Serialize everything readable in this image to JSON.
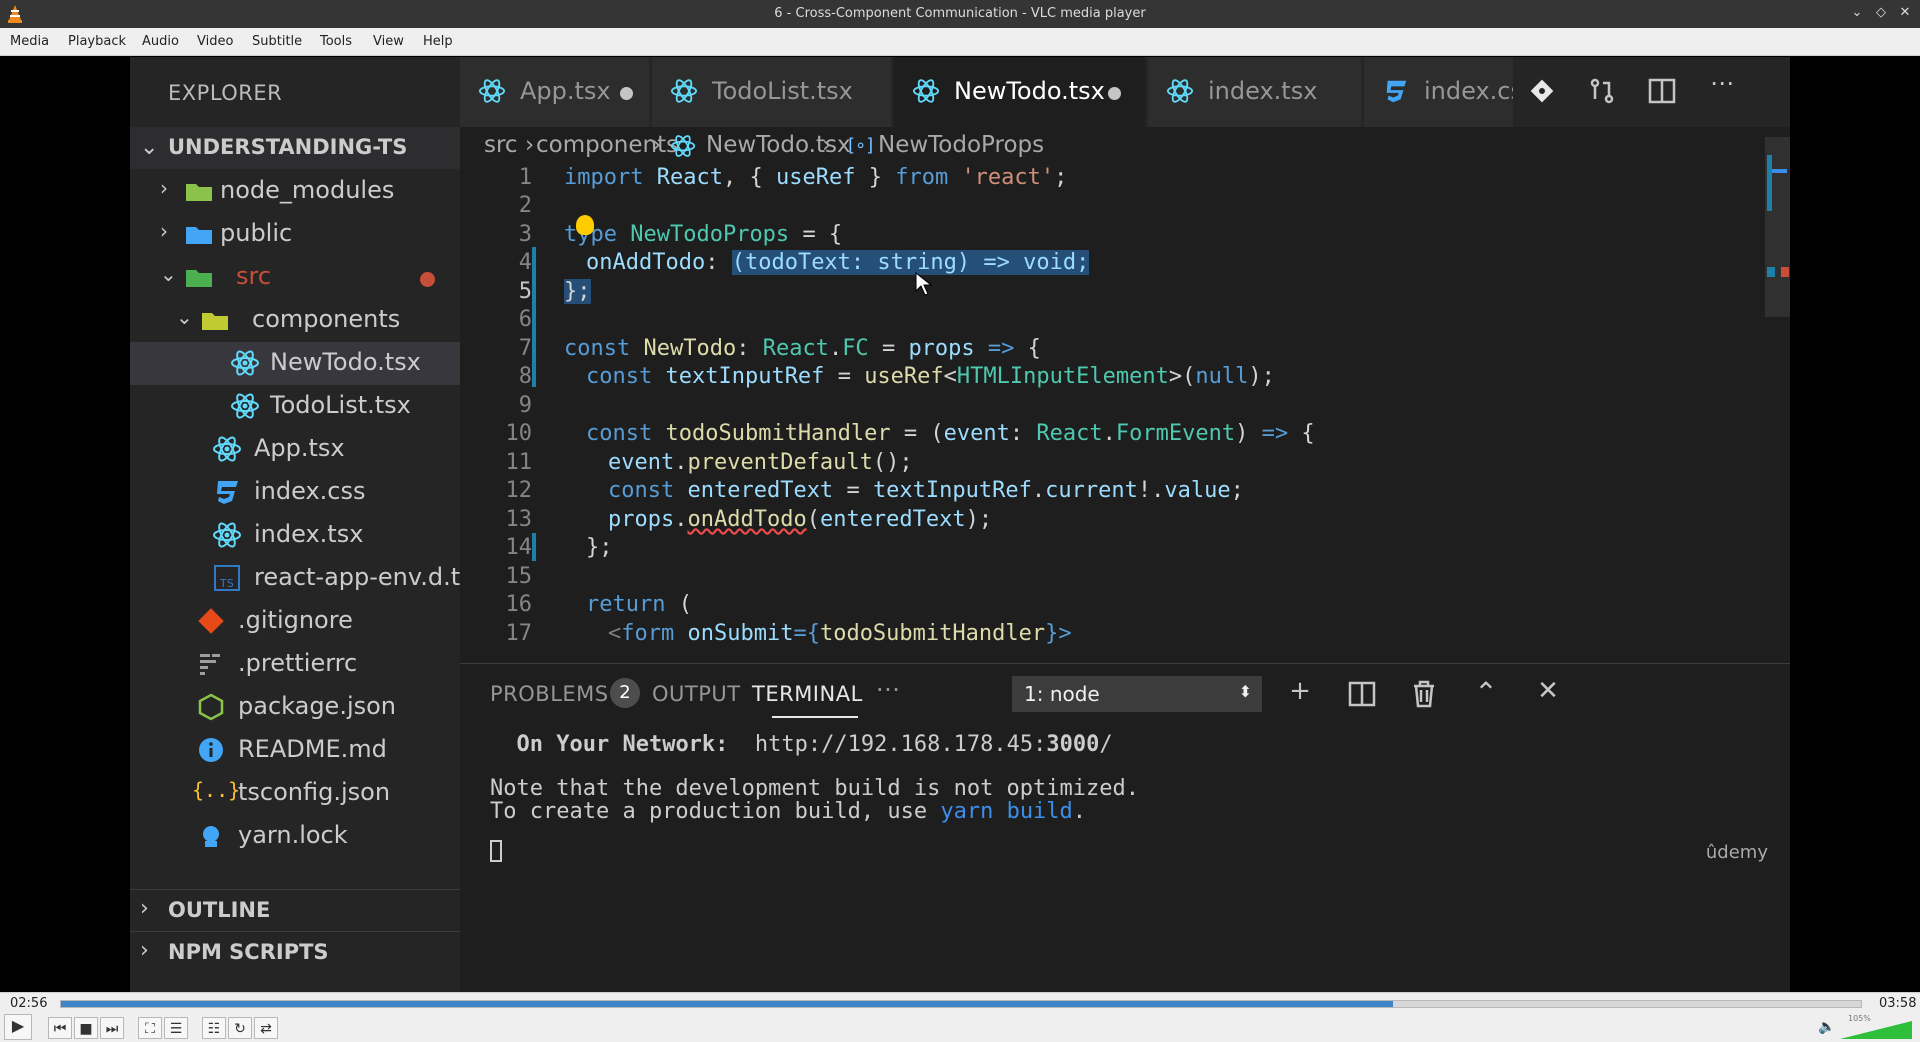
{
  "window": {
    "title": "6 - Cross-Component Communication - VLC media player"
  },
  "menu": [
    "Media",
    "Playback",
    "Audio",
    "Video",
    "Subtitle",
    "Tools",
    "View",
    "Help"
  ],
  "explorer": {
    "header": "EXPLORER",
    "project": "UNDERSTANDING-TS",
    "items": [
      {
        "label": "node_modules"
      },
      {
        "label": "public"
      },
      {
        "label": "src"
      },
      {
        "label": "components"
      },
      {
        "label": "NewTodo.tsx"
      },
      {
        "label": "TodoList.tsx"
      },
      {
        "label": "App.tsx"
      },
      {
        "label": "index.css"
      },
      {
        "label": "index.tsx"
      },
      {
        "label": "react-app-env.d.ts"
      },
      {
        "label": ".gitignore"
      },
      {
        "label": ".prettierrc"
      },
      {
        "label": "package.json"
      },
      {
        "label": "README.md"
      },
      {
        "label": "tsconfig.json"
      },
      {
        "label": "yarn.lock"
      }
    ],
    "outline": "OUTLINE",
    "npm_scripts": "NPM SCRIPTS"
  },
  "tabs": [
    {
      "label": "App.tsx"
    },
    {
      "label": "TodoList.tsx"
    },
    {
      "label": "NewTodo.tsx"
    },
    {
      "label": "index.tsx"
    },
    {
      "label": "index.cs"
    }
  ],
  "breadcrumb": [
    "src",
    "components",
    "NewTodo.tsx",
    "NewTodoProps"
  ],
  "line_numbers": [
    "1",
    "2",
    "3",
    "4",
    "5",
    "6",
    "7",
    "8",
    "9",
    "10",
    "11",
    "12",
    "13",
    "14",
    "15",
    "16",
    "17"
  ],
  "code": {
    "l1": [
      "import",
      "React",
      ", {",
      "useRef",
      "}",
      "from",
      "'react'",
      ";"
    ],
    "l3": [
      "type",
      "NewTodoProps",
      "= {"
    ],
    "l4": [
      "onAddTodo",
      ":",
      "(todoText: string) => void;"
    ],
    "l5": "};",
    "l7": [
      "const",
      "NewTodo",
      ":",
      "React",
      ".",
      "FC",
      "=",
      "props",
      "=>",
      "{"
    ],
    "l8": [
      "const",
      "textInputRef",
      "=",
      "useRef",
      "<",
      "HTMLInputElement",
      ">(",
      "null",
      ");"
    ],
    "l10": [
      "const",
      "todoSubmitHandler",
      "= (",
      "event",
      ":",
      "React",
      ".",
      "FormEvent",
      ")",
      "=>",
      "{"
    ],
    "l11": [
      "event",
      ".",
      "preventDefault",
      "();"
    ],
    "l12": [
      "const",
      "enteredText",
      "=",
      "textInputRef",
      ".",
      "current",
      "!.",
      "value",
      ";"
    ],
    "l13": [
      "props",
      ".",
      "onAddTodo",
      "(",
      "enteredText",
      ");"
    ],
    "l14": "};",
    "l16": [
      "return",
      "("
    ],
    "l17": [
      "<",
      "form",
      "onSubmit",
      "={",
      "todoSubmitHandler",
      "}>"
    ]
  },
  "panel": {
    "tabs": [
      "PROBLEMS",
      "OUTPUT",
      "TERMINAL",
      "···"
    ],
    "problems_count": "2",
    "terminal_select": "1: node",
    "select_arrow": "⬍",
    "terminal_lines": {
      "net_label": "On Your Network:",
      "net_url_prefix": "http://192.168.178.45:",
      "net_port": "3000",
      "net_url_suffix": "/",
      "note1": "Note that the development build is not optimized.",
      "note2_prefix": "To create a production build, use ",
      "note2_cmd": "yarn build",
      "note2_suffix": "."
    },
    "watermark": "ûdemy"
  },
  "player": {
    "elapsed": "02:56",
    "total": "03:58",
    "progress": 0.74,
    "volume_label": "105%",
    "volume": 1.05
  },
  "colors": {
    "accent": "#3d85c6",
    "vscode_bg": "#1e1e1e",
    "sidebar_bg": "#252526"
  }
}
